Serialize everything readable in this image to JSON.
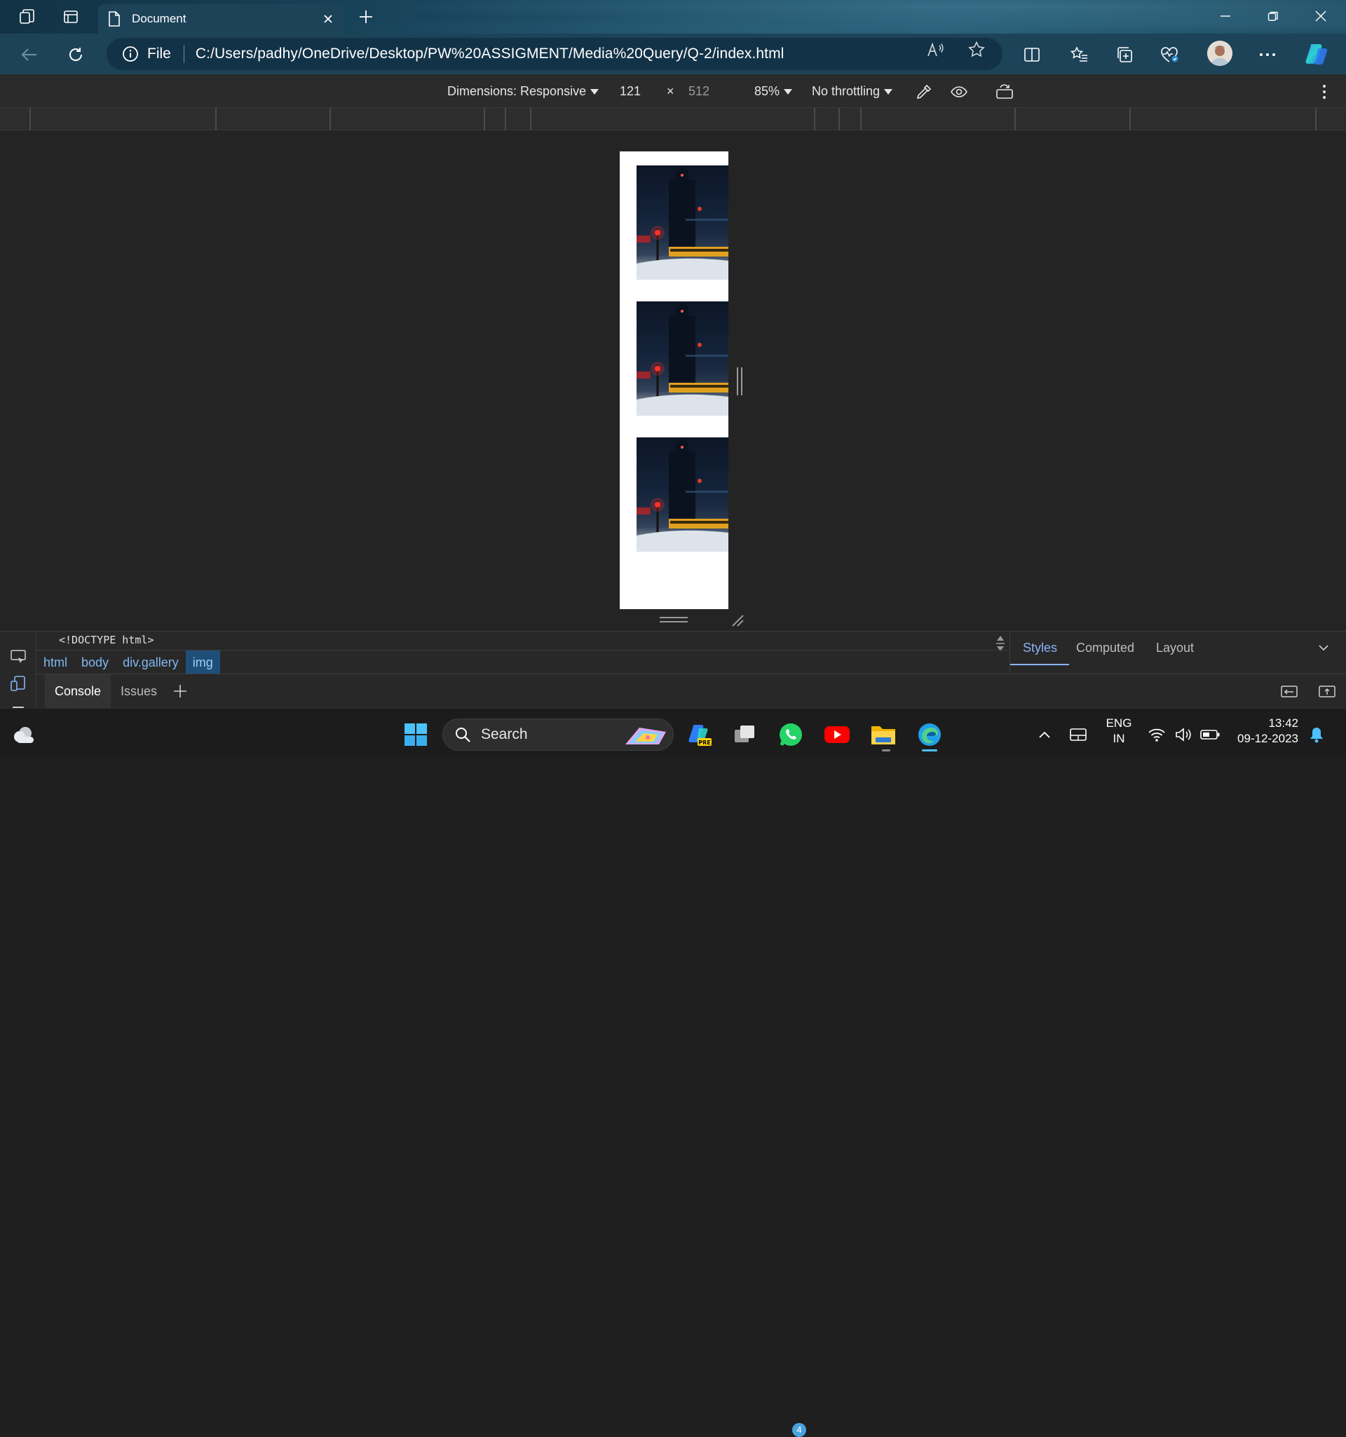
{
  "tab": {
    "title": "Document"
  },
  "address": {
    "scheme": "File",
    "url": "C:/Users/padhy/OneDrive/Desktop/PW%20ASSIGMENT/Media%20Query/Q-2/index.html"
  },
  "device_toolbar": {
    "dimensions": "Dimensions: Responsive",
    "width": "121",
    "times": "×",
    "height": "512",
    "zoom": "85%",
    "throttling": "No throttling"
  },
  "page": {
    "images": [
      {
        "name": "gallery-image-1"
      },
      {
        "name": "gallery-image-2"
      },
      {
        "name": "gallery-image-3"
      }
    ]
  },
  "devtools": {
    "doctype": "<!DOCTYPE html>",
    "breadcrumbs": [
      "html",
      "body",
      "div.gallery",
      "img"
    ],
    "style_tabs": [
      "Styles",
      "Computed",
      "Layout"
    ],
    "drawer_tabs": [
      "Console",
      "Issues"
    ]
  },
  "taskbar": {
    "search_label": "Search",
    "whatsapp_badge": "4",
    "language": "ENG",
    "region": "IN",
    "time": "13:42",
    "date": "09-12-2023"
  },
  "colors": {
    "tab_strip": "#1b4a62",
    "toolbar": "#1d4359",
    "devtools_bg": "#282828",
    "link_blue": "#7fb8f0",
    "accent": "#4cc2ff"
  }
}
